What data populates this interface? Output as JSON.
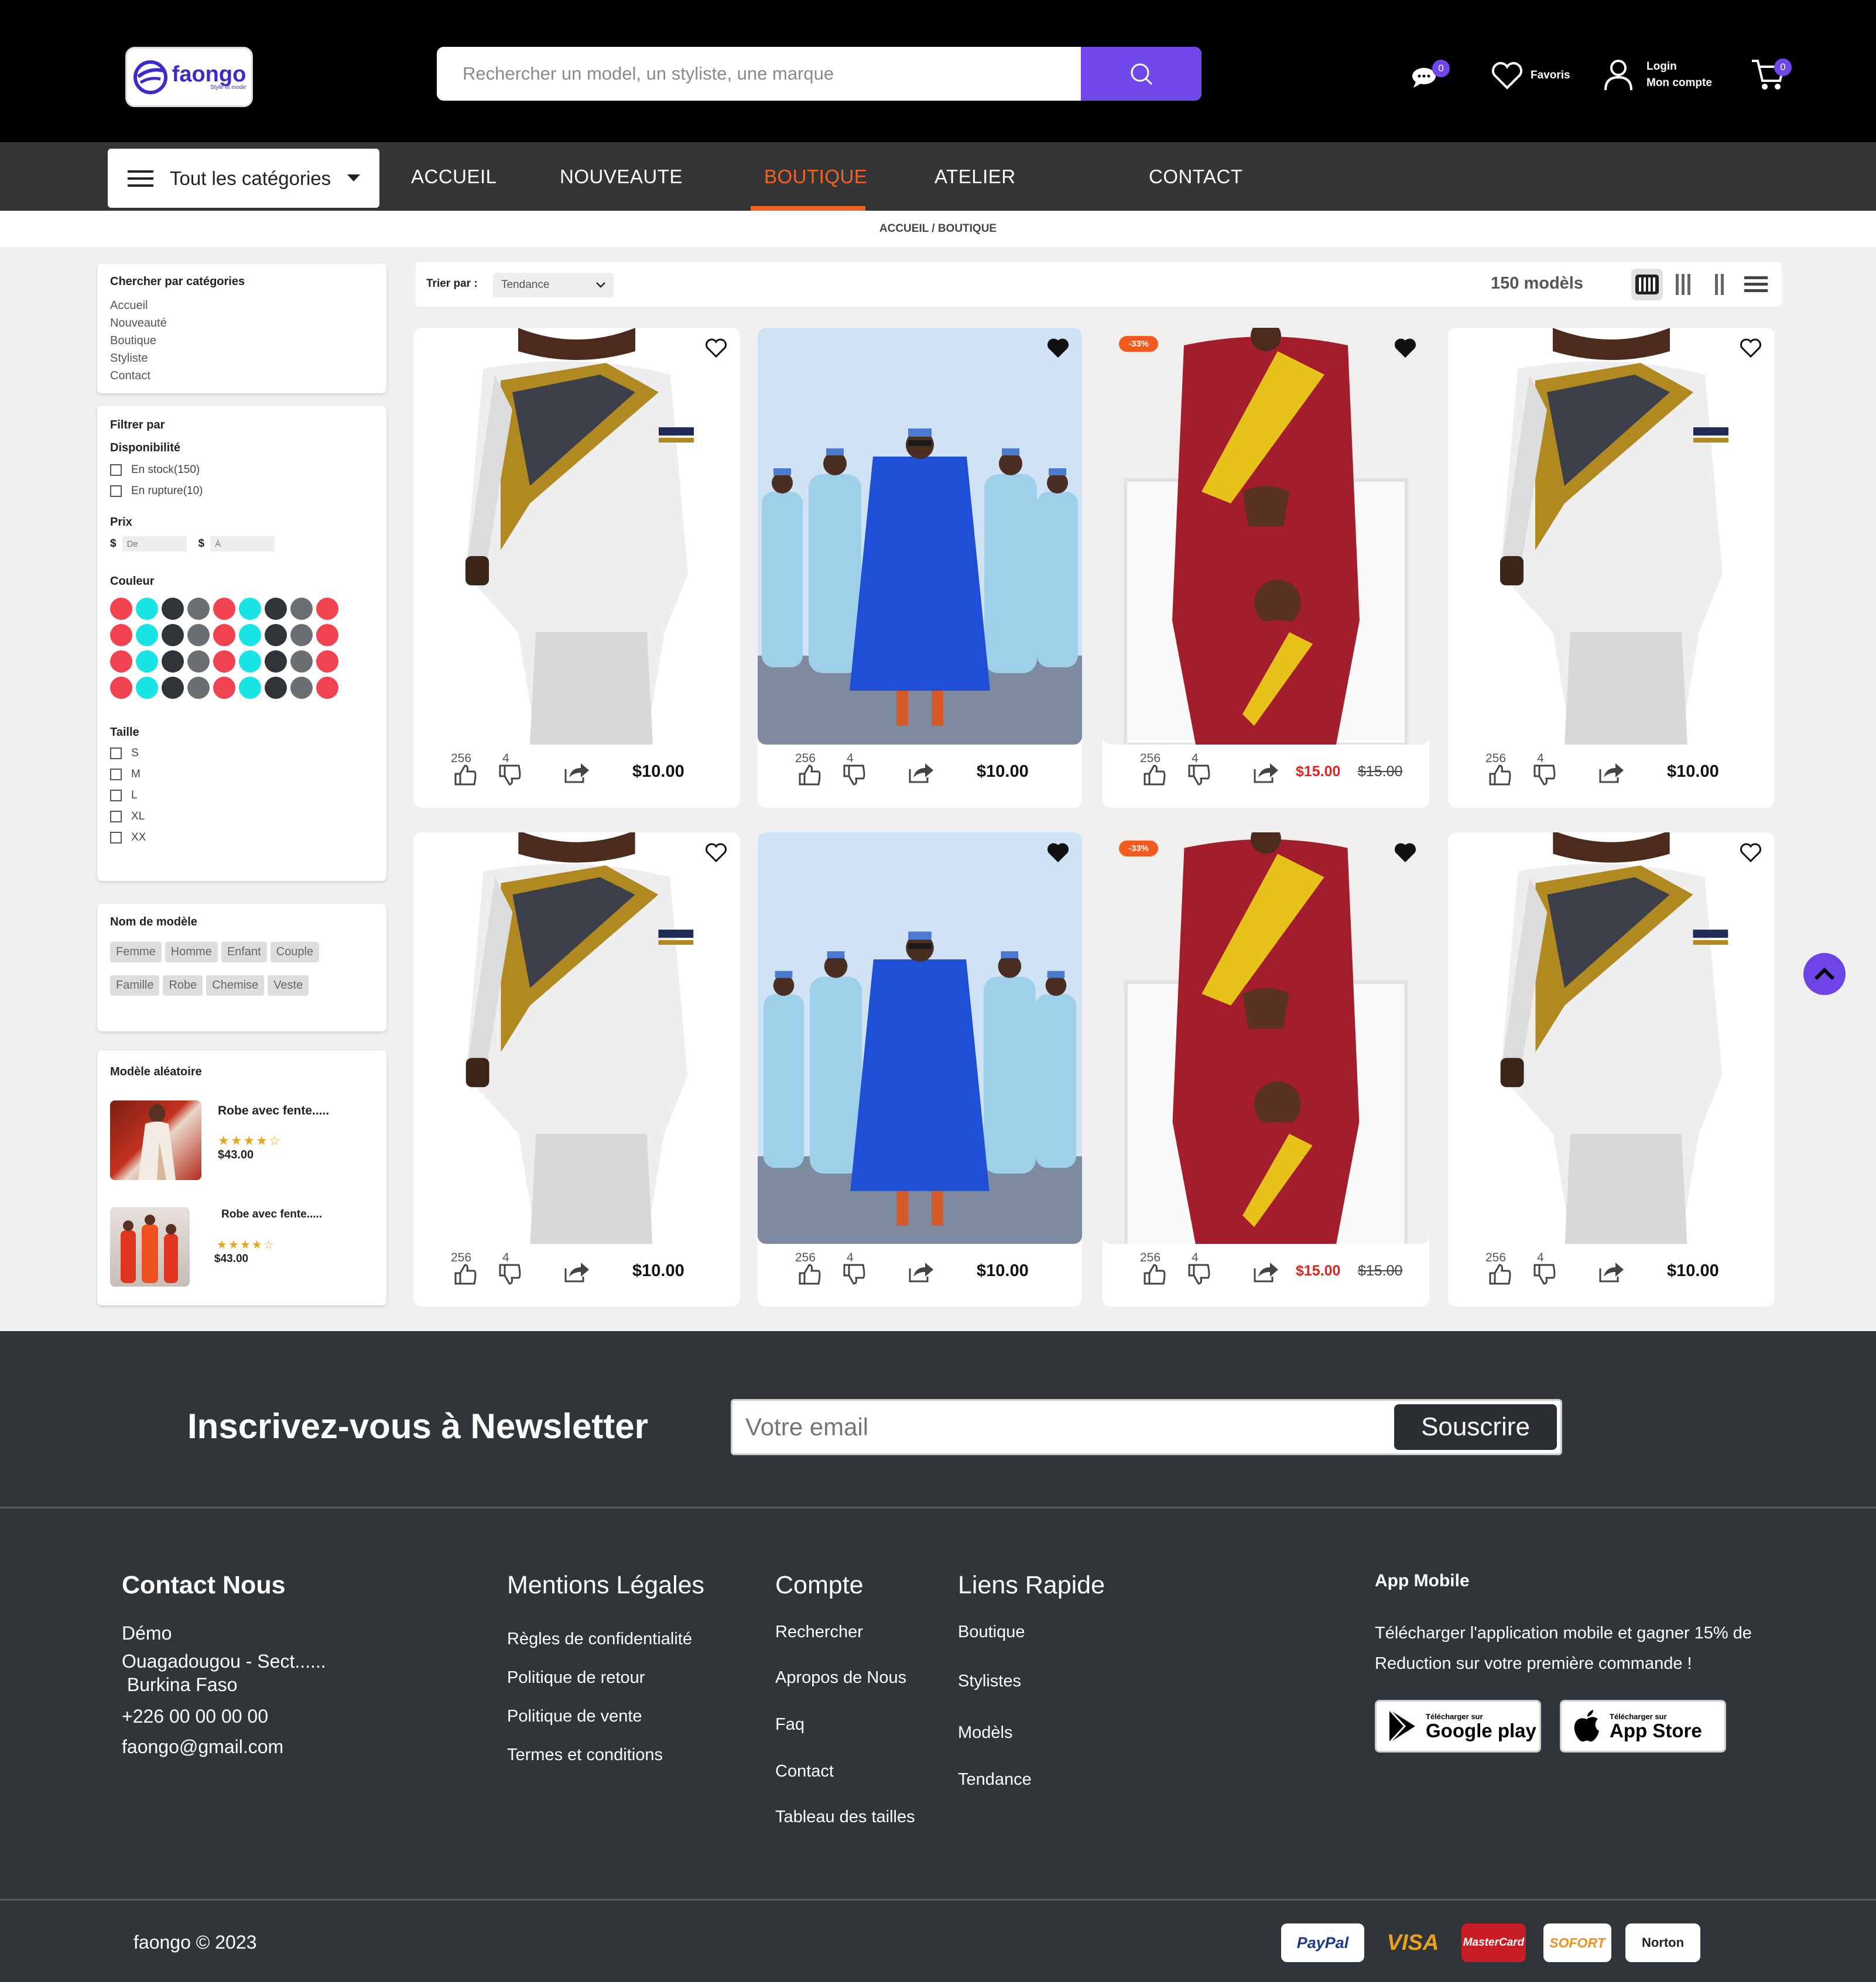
{
  "header": {
    "logo_text": "faongo",
    "logo_tagline": "Style et mode",
    "search_placeholder": "Rechercher un model, un styliste, une marque",
    "messages_badge": "0",
    "favorites_label": "Favoris",
    "login_label": "Login",
    "account_label": "Mon compte",
    "cart_badge": "0"
  },
  "nav": {
    "categories_button": "Tout les catégories",
    "links": [
      "ACCUEIL",
      "NOUVEAUTE",
      "BOUTIQUE",
      "ATELIER",
      "CONTACT"
    ],
    "active": "BOUTIQUE"
  },
  "breadcrumb": "ACCUEIL / BOUTIQUE",
  "sidebar": {
    "categories": {
      "title": "Chercher par catégories",
      "items": [
        "Accueil",
        "Nouveauté",
        "Boutique",
        "Styliste",
        "Contact"
      ]
    },
    "filters": {
      "title": "Filtrer par",
      "availability_title": "Disponibilité",
      "availability": [
        "En stock(150)",
        "En rupture(10)"
      ],
      "price_title": "Prix",
      "currency": "$",
      "price_from_placeholder": "De",
      "price_to_placeholder": "À",
      "color_title": "Couleur",
      "colors": [
        "#f0434f",
        "#19e4e4",
        "#2f3438",
        "#6b6f72"
      ],
      "size_title": "Taille",
      "sizes": [
        "S",
        "M",
        "L",
        "XL",
        "XX"
      ]
    },
    "model_names": {
      "title": "Nom de modèle",
      "tags": [
        "Femme",
        "Homme",
        "Enfant",
        "Couple",
        "Famille",
        "Robe",
        "Chemise",
        "Veste"
      ]
    },
    "random": {
      "title": "Modèle aléatoire",
      "items": [
        {
          "name": "Robe avec fente.....",
          "rating": 4,
          "price": "$43.00"
        },
        {
          "name": "Robe avec fente.....",
          "rating": 4,
          "price": "$43.00"
        }
      ]
    }
  },
  "sortbar": {
    "label": "Trier par :",
    "selected": "Tendance",
    "count": "150 modèls"
  },
  "products": [
    {
      "image": "white-shirt",
      "likes": "256",
      "dislikes": "4",
      "price": "$10.00",
      "old_price": "",
      "discount": "",
      "favorited": false
    },
    {
      "image": "agbada-group",
      "likes": "256",
      "dislikes": "4",
      "price": "$10.00",
      "old_price": "",
      "discount": "",
      "favorited": true
    },
    {
      "image": "red-father-son",
      "likes": "256",
      "dislikes": "4",
      "price": "$15.00",
      "old_price": "$15.00",
      "discount": "-33%",
      "favorited": true
    },
    {
      "image": "white-shirt",
      "likes": "256",
      "dislikes": "4",
      "price": "$10.00",
      "old_price": "",
      "discount": "",
      "favorited": false
    },
    {
      "image": "white-shirt",
      "likes": "256",
      "dislikes": "4",
      "price": "$10.00",
      "old_price": "",
      "discount": "",
      "favorited": false
    },
    {
      "image": "agbada-group",
      "likes": "256",
      "dislikes": "4",
      "price": "$10.00",
      "old_price": "",
      "discount": "",
      "favorited": true
    },
    {
      "image": "red-father-son",
      "likes": "256",
      "dislikes": "4",
      "price": "$15.00",
      "old_price": "$15.00",
      "discount": "-33%",
      "favorited": true
    },
    {
      "image": "white-shirt",
      "likes": "256",
      "dislikes": "4",
      "price": "$10.00",
      "old_price": "",
      "discount": "",
      "favorited": false
    }
  ],
  "newsletter": {
    "title": "Inscrivez-vous à Newsletter",
    "placeholder": "Votre email",
    "button": "Souscrire"
  },
  "footer": {
    "contact": {
      "title": "Contact Nous",
      "lines": [
        "Démo",
        "Ouagadougou - Sect......",
        " Burkina Faso",
        "+226 00 00 00 00",
        "faongo@gmail.com"
      ]
    },
    "legal": {
      "title": "Mentions Légales",
      "links": [
        "Règles de confidentialité",
        "Politique de retour",
        "Politique de vente",
        "Termes et conditions"
      ]
    },
    "account": {
      "title": "Compte",
      "links": [
        "Rechercher",
        "Apropos de Nous",
        "Faq",
        "Contact",
        "Tableau des tailles"
      ]
    },
    "quick": {
      "title": "Liens Rapide",
      "links": [
        "Boutique",
        "Stylistes",
        "Modèls",
        "Tendance"
      ]
    },
    "app": {
      "title": "App Mobile",
      "text": "Télécharger l'application mobile et gagner 15% de Reduction sur votre première commande !",
      "google_small": "Télécharger sur",
      "google_big": "Google play",
      "apple_small": "Télécharger sur",
      "apple_big": "App Store"
    },
    "copyright": "faongo © 2023",
    "payments": [
      "PayPal",
      "VISA",
      "MasterCard",
      "SOFORT",
      "Norton"
    ]
  },
  "colors": {
    "accent": "#7047e8",
    "nav_active": "#f26322",
    "discount": "#f25a1e",
    "sale_price": "#e0241c"
  }
}
